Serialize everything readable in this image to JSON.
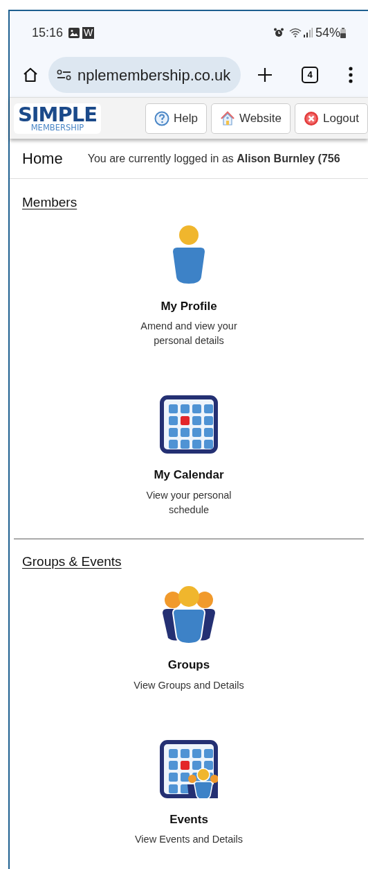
{
  "status_bar": {
    "time": "15:16",
    "notification_letter": "W",
    "battery": "54%"
  },
  "browser": {
    "url": "nplemembership.co.uk",
    "tab_count": "4"
  },
  "header": {
    "logo_title": "SIMPLE",
    "logo_subtitle": "MEMBERSHIP",
    "buttons": [
      {
        "kind": "help",
        "label": "Help"
      },
      {
        "kind": "website",
        "label": "Website"
      },
      {
        "kind": "logout",
        "label": "Logout"
      }
    ]
  },
  "breadcrumb": {
    "title": "Home",
    "login_text": "You are currently logged in as **Alison Burnley (756**"
  },
  "sections": [
    {
      "heading": "Members",
      "items": [
        {
          "kind": "profile",
          "title": "My Profile",
          "description": "Amend and view your personal details"
        },
        {
          "kind": "calendar",
          "title": "My Calendar",
          "description": "View your personal schedule"
        }
      ]
    },
    {
      "heading": "Groups & Events",
      "items": [
        {
          "kind": "groups",
          "title": "Groups",
          "description": "View Groups and Details"
        },
        {
          "kind": "events",
          "title": "Events",
          "description": "View Events and Details"
        }
      ]
    }
  ]
}
